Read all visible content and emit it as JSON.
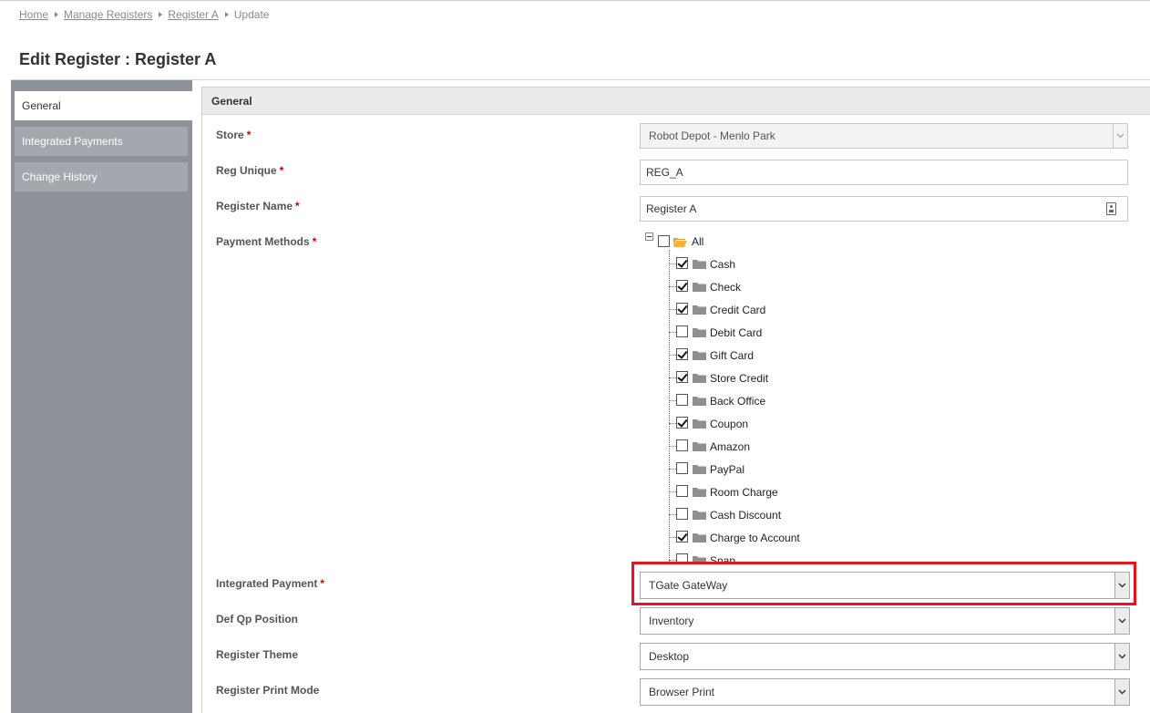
{
  "breadcrumb": {
    "home": "Home",
    "manage_registers": "Manage Registers",
    "register": "Register A",
    "current": "Update"
  },
  "page_title": "Edit Register : Register A",
  "sidebar": {
    "items": [
      {
        "label": "General",
        "active": true
      },
      {
        "label": "Integrated Payments",
        "active": false
      },
      {
        "label": "Change History",
        "active": false
      }
    ]
  },
  "panel": {
    "header": "General"
  },
  "form": {
    "store": {
      "label": "Store",
      "value": "Robot Depot - Menlo Park"
    },
    "reg_unique": {
      "label": "Reg Unique",
      "value": "REG_A"
    },
    "register_name": {
      "label": "Register Name",
      "value": "Register A"
    },
    "payment_methods": {
      "label": "Payment Methods"
    },
    "integrated_payment": {
      "label": "Integrated Payment",
      "value": "TGate GateWay"
    },
    "def_qp_position": {
      "label": "Def Qp Position",
      "value": "Inventory"
    },
    "register_theme": {
      "label": "Register Theme",
      "value": "Desktop"
    },
    "register_print_mode": {
      "label": "Register Print Mode",
      "value": "Browser Print"
    },
    "required_mark": "*"
  },
  "payment_tree": {
    "root": {
      "label": "All",
      "checked": false
    },
    "items": [
      {
        "label": "Cash",
        "checked": true
      },
      {
        "label": "Check",
        "checked": true
      },
      {
        "label": "Credit Card",
        "checked": true
      },
      {
        "label": "Debit Card",
        "checked": false
      },
      {
        "label": "Gift Card",
        "checked": true
      },
      {
        "label": "Store Credit",
        "checked": true
      },
      {
        "label": "Back Office",
        "checked": false
      },
      {
        "label": "Coupon",
        "checked": true
      },
      {
        "label": "Amazon",
        "checked": false
      },
      {
        "label": "PayPal",
        "checked": false
      },
      {
        "label": "Room Charge",
        "checked": false
      },
      {
        "label": "Cash Discount",
        "checked": false
      },
      {
        "label": "Charge to Account",
        "checked": true
      },
      {
        "label": "Snap",
        "checked": false
      }
    ]
  },
  "colors": {
    "highlight": "#e8141c",
    "sidebar_bg": "#8e939b",
    "folder_open": "#f0a030",
    "folder": "#8f8f8f"
  }
}
